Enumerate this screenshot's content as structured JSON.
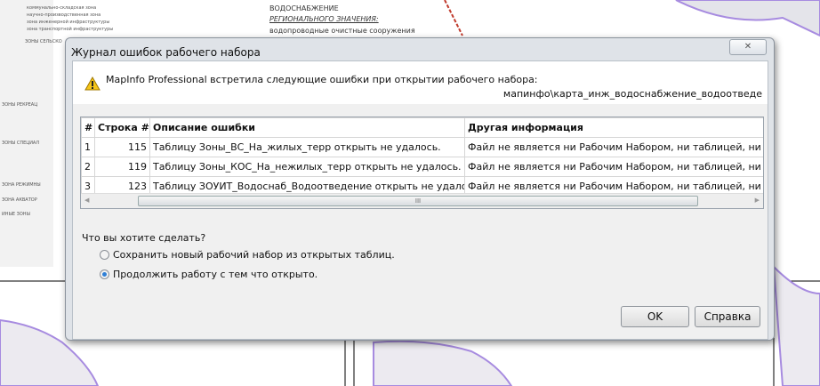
{
  "background_map": {
    "legend_items": [
      "коммунально-складская зона",
      "научно-производственная зона",
      "зона инженерной инфраструктуры",
      "зона транспортной инфраструктуры",
      "ЗОНЫ СЕЛЬСКО",
      "ЗОНЫ РЕКРЕАЦ",
      "ЗОНЫ СПЕЦИАЛ",
      "ЗОНА РЕЖИМНЫ",
      "ЗОНА АКВАТОР",
      "ИНЫЕ ЗОНЫ"
    ],
    "heading": "ВОДОСНАБЖЕНИЕ",
    "subheading": "РЕГИОНАЛЬНОГО ЗНАЧЕНИЯ:",
    "item": "водопроводные очистные сооружения"
  },
  "dialog": {
    "title": "Журнал ошибок рабочего набора",
    "close_icon": "close-icon",
    "message": "MapInfo Professional встретила следующие ошибки при открытии рабочего набора:",
    "path": "мапинфо\\карта_инж_водоснабжение_водоотведе",
    "table": {
      "headers": [
        "#",
        "Строка #",
        "Описание ошибки",
        "Другая информация"
      ],
      "rows": [
        [
          "1",
          "115",
          "Таблицу Зоны_ВС_На_жилых_терр открыть не удалось.",
          "Файл не является ни Рабочим Набором, ни таблицей, ни пр"
        ],
        [
          "2",
          "119",
          "Таблицу Зоны_КОС_На_нежилых_терр открыть не удалось.",
          "Файл не является ни Рабочим Набором, ни таблицей, ни пр"
        ],
        [
          "3",
          "123",
          "Таблицу ЗОУИТ_Водоснаб_Водоотведение открыть не удалось.",
          "Файл не является ни Рабочим Набором, ни таблицей, ни пр"
        ]
      ],
      "scroll_grip": "III"
    },
    "question": "Что вы хотите сделать?",
    "options": [
      {
        "label": "Сохранить новый рабочий набор из открытых таблиц.",
        "selected": false
      },
      {
        "label": "Продолжить работу с тем что открыто.",
        "selected": true
      }
    ],
    "ok_label": "OK",
    "help_label": "Справка",
    "accent_color": "#2f7fd6"
  }
}
